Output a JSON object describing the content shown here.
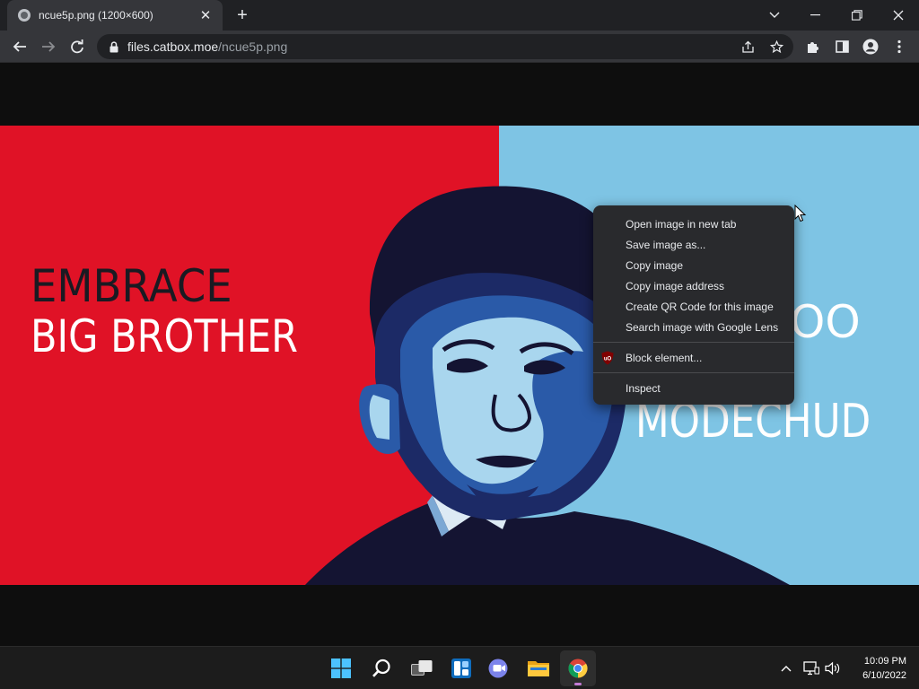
{
  "browser": {
    "tab_title": "ncue5p.png (1200×600)",
    "tab_close_glyph": "✕",
    "newtab_glyph": "+",
    "url_host": "files.catbox.moe",
    "url_path": "/ncue5p.png",
    "window_controls": [
      "chevron-down-icon",
      "minimize-icon",
      "restore-icon",
      "close-icon"
    ],
    "toolbar_icons": [
      "back-icon",
      "forward-icon",
      "reload-icon",
      "lock-icon",
      "share-icon",
      "star-icon",
      "extensions-icon",
      "sidepanel-icon",
      "profile-icon",
      "menu-icon"
    ]
  },
  "poster": {
    "headline_line1": "EMBRACE",
    "headline_line2": "BIG BROTHER",
    "right_line1": "OO",
    "right_line2": "MODECHUD",
    "colors": {
      "left_bg": "#e01226",
      "right_bg": "#7ec4e4",
      "dark": "#141432",
      "mid": "#2a5aa8",
      "light": "#a9d6ee"
    }
  },
  "context_menu": {
    "items": [
      "Open image in new tab",
      "Save image as...",
      "Copy image",
      "Copy image address",
      "Create QR Code for this image",
      "Search image with Google Lens"
    ],
    "extension_item": "Block element...",
    "extension_icon": "ublock-origin-icon",
    "inspect": "Inspect"
  },
  "taskbar": {
    "apps": [
      "windows-start-icon",
      "search-icon",
      "task-view-icon",
      "widgets-icon",
      "teams-chat-icon",
      "file-explorer-icon",
      "chrome-icon"
    ],
    "active_app": "chrome-icon",
    "tray_icons": [
      "chevron-up-icon",
      "network-icon",
      "volume-icon"
    ],
    "time": "10:09 PM",
    "date": "6/10/2022"
  }
}
